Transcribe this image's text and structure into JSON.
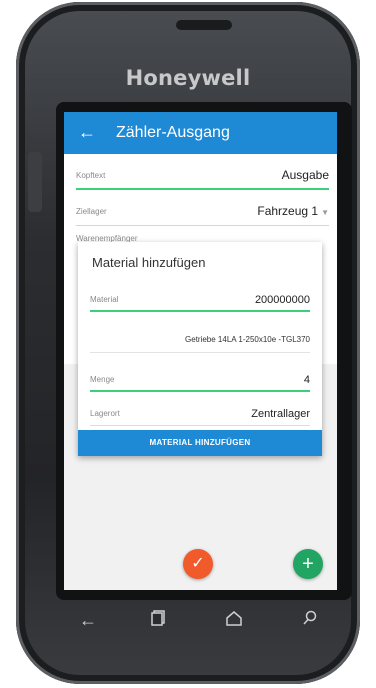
{
  "device": {
    "brand": "Honeywell"
  },
  "appbar": {
    "back_icon": "arrow-left-icon",
    "title": "Zähler-Ausgang"
  },
  "form": {
    "kopftext": {
      "label": "Kopftext",
      "value": "Ausgabe"
    },
    "ziellager": {
      "label": "Ziellager",
      "value": "Fahrzeug 1"
    },
    "warenempfaenger": {
      "label": "Warenempfänger"
    }
  },
  "dialog": {
    "title": "Material hinzufügen",
    "material": {
      "label": "Material",
      "value": "200000000"
    },
    "description": "Getriebe 14LA 1-250x10e -TGL370",
    "menge": {
      "label": "Menge",
      "value": "4"
    },
    "lagerort": {
      "label": "Lagerort",
      "value": "Zentrallager"
    },
    "button_label": "MATERIAL HINZUFÜGEN"
  },
  "fabs": {
    "confirm_icon": "check-icon",
    "add_icon": "plus-icon"
  },
  "navbar": {
    "icons": [
      "back-icon",
      "recent-apps-icon",
      "home-icon",
      "search-icon"
    ]
  },
  "colors": {
    "primary": "#1e8ad6",
    "accent_green": "#3ecf7a",
    "fab_orange": "#f15a2b",
    "fab_green": "#22a562"
  }
}
